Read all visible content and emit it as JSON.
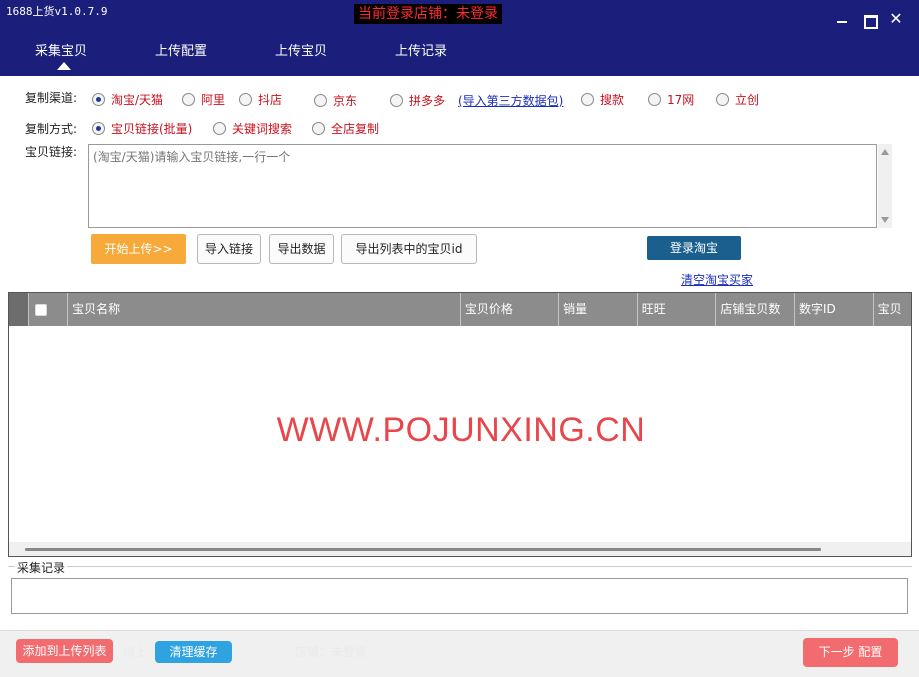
{
  "app": {
    "title": "1688上货v1.0.7.9",
    "login_status": "当前登录店铺：未登录",
    "close_glyph": "✕"
  },
  "nav": {
    "tabs": [
      {
        "label": "采集宝贝",
        "active": true
      },
      {
        "label": "上传配置"
      },
      {
        "label": "上传宝贝"
      },
      {
        "label": "上传记录"
      }
    ]
  },
  "channel": {
    "label": "复制渠道:",
    "options": [
      "淘宝/天猫",
      "阿里",
      "抖店",
      "京东",
      "拼多多",
      "搜款",
      "17网",
      "立创"
    ],
    "selected": "淘宝/天猫",
    "import_link": "(导入第三方数据包)"
  },
  "method": {
    "label": "复制方式:",
    "options": [
      "宝贝链接(批量)",
      "关键词搜索",
      "全店复制"
    ],
    "selected": "宝贝链接(批量)"
  },
  "links": {
    "label": "宝贝链接:",
    "placeholder": "(淘宝/天猫)请输入宝贝链接,一行一个"
  },
  "actions": {
    "start_upload": "开始上传>>",
    "import_links": "导入链接",
    "export_data": "导出数据",
    "export_ids": "导出列表中的宝贝id",
    "login_taobao": "登录淘宝",
    "clear_buyer": "清空淘宝买家"
  },
  "table": {
    "columns": [
      "全选",
      "宝贝名称",
      "宝贝价格",
      "销量",
      "旺旺",
      "店铺宝贝数",
      "数字ID",
      "宝贝"
    ],
    "rows": []
  },
  "watermark": "WWW.POJUNXING.CN",
  "log": {
    "label": "采集记录"
  },
  "bottom": {
    "add_to_list": "添加到上传列表",
    "clear_cache": "清理缓存",
    "faint_left": "待上",
    "faint_right": "店铺：未登录",
    "next_step": "下一步 配置"
  },
  "colors": {
    "header_bg": "#1b1e7a",
    "option_red": "#c8101e",
    "orange": "#f7a93a",
    "navy_button": "#1b5f8e",
    "pink": "#f26c6f",
    "cyan": "#2fa3e0",
    "watermark": "#e8464a"
  }
}
